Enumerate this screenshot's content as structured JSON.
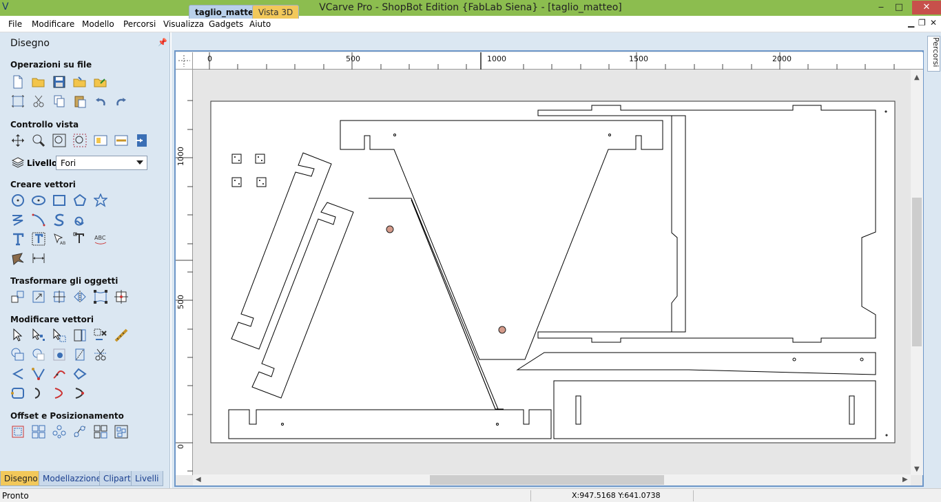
{
  "window": {
    "title": "VCarve Pro - ShopBot Edition {FabLab Siena} - [taglio_matteo]",
    "app_icon": "V",
    "minimize": "‒",
    "maximize": "□",
    "close": "✕"
  },
  "menubar": {
    "items": [
      "File",
      "Modificare",
      "Modello",
      "Percorsi",
      "Visualizza",
      "Gadgets",
      "Aiuto"
    ],
    "mdi_min": "▁",
    "mdi_restore": "❐",
    "mdi_close": "✕"
  },
  "left_panel": {
    "title": "Disegno",
    "pin": "📌",
    "sections": {
      "file_ops": "Operazioni su file",
      "view_control": "Controllo vista",
      "create_vectors": "Creare vettori",
      "transform": "Trasformare gli oggetti",
      "edit_vectors": "Modificare vettori",
      "offset": "Offset e Posizionamento"
    },
    "layer": {
      "label": "Livello",
      "value": "Fori"
    },
    "tabs": [
      "Disegno",
      "Modellazzione",
      "Clipart",
      "Livelli"
    ]
  },
  "document": {
    "tabs": [
      "taglio_matteo",
      "Vista 3D"
    ]
  },
  "rulers": {
    "top": [
      "0",
      "500",
      "1000",
      "1500",
      "2000"
    ],
    "left": [
      "1000",
      "500",
      "0"
    ]
  },
  "right_panel": {
    "tab": "Percorsi"
  },
  "status": {
    "text": "Pronto",
    "coords": "X:947.5168 Y:641.0738"
  }
}
